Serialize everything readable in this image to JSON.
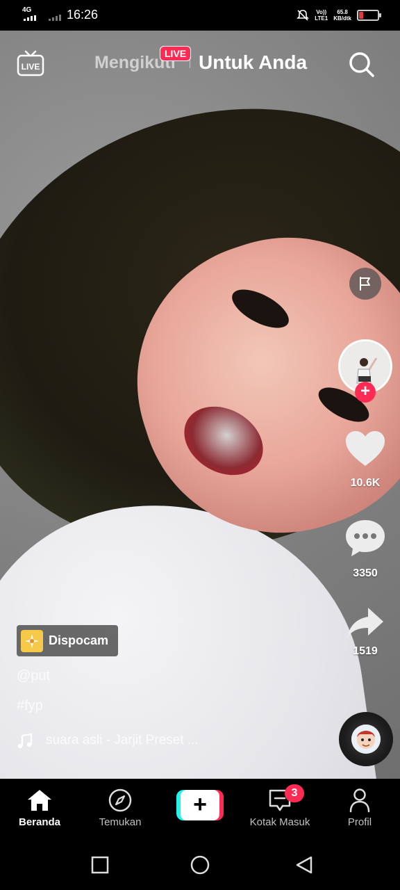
{
  "status_bar": {
    "network": "4G",
    "time": "16:26",
    "volte": "Vo))\nLTE1",
    "speed": "65.8\nKB/dtk",
    "battery_color": "#e03a3a"
  },
  "top_nav": {
    "tab_following": "Mengikuti",
    "live_badge": "LIVE",
    "tab_for_you": "Untuk Anda",
    "live_icon_label": "LIVE"
  },
  "rail": {
    "likes": "10.6K",
    "comments": "3350",
    "shares": "1519",
    "follow_symbol": "+"
  },
  "post": {
    "effect": "Dispocam",
    "username": "@put",
    "hashtag": "#fyp",
    "sound": "suara asli - Jarjit Preset ..."
  },
  "tab_bar": {
    "home": "Beranda",
    "discover": "Temukan",
    "create_symbol": "+",
    "inbox": "Kotak Masuk",
    "inbox_count": "3",
    "profile": "Profil"
  },
  "colors": {
    "accent": "#fe2c55",
    "cyan": "#25f4ee"
  },
  "icons": [
    "live-icon",
    "search-icon",
    "flag-icon",
    "heart-icon",
    "comment-icon",
    "share-icon",
    "music-note-icon",
    "home-icon",
    "compass-icon",
    "inbox-icon",
    "profile-icon",
    "square-icon",
    "circle-icon",
    "back-icon"
  ]
}
